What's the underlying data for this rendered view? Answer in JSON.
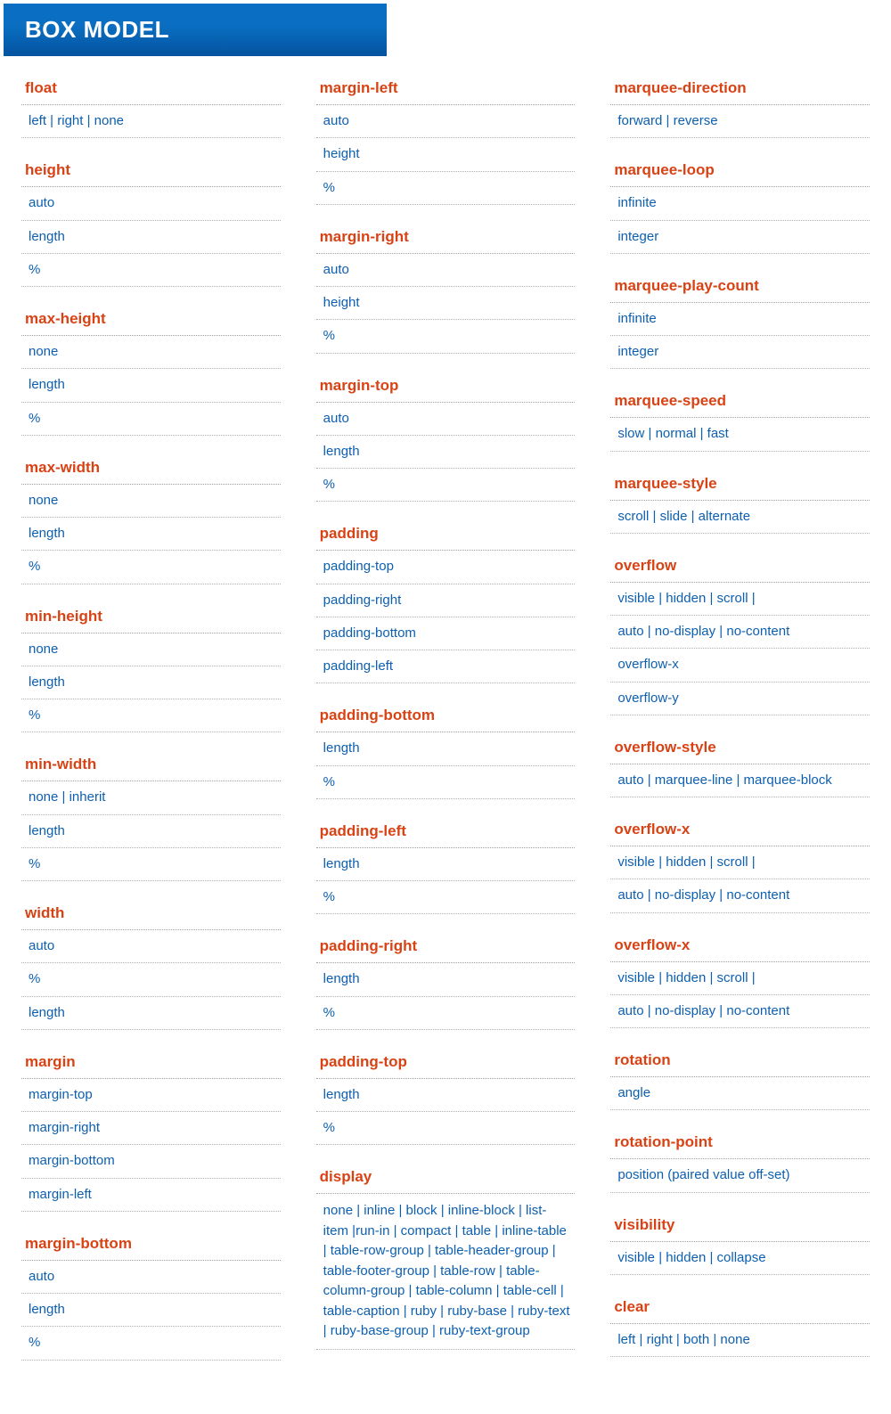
{
  "title": "BOX MODEL",
  "columns": [
    [
      {
        "name": "float",
        "values": [
          "left | right | none"
        ]
      },
      {
        "name": "height",
        "values": [
          "auto",
          "length",
          "%"
        ]
      },
      {
        "name": "max-height",
        "values": [
          "none",
          "length",
          "%"
        ]
      },
      {
        "name": "max-width",
        "values": [
          "none",
          "length",
          "%"
        ]
      },
      {
        "name": "min-height",
        "values": [
          "none",
          "length",
          "%"
        ]
      },
      {
        "name": "min-width",
        "values": [
          "none | inherit",
          "length",
          "%"
        ]
      },
      {
        "name": "width",
        "values": [
          "auto",
          "%",
          "length"
        ]
      },
      {
        "name": "margin",
        "values": [
          "margin-top",
          "margin-right",
          "margin-bottom",
          "margin-left"
        ]
      },
      {
        "name": "margin-bottom",
        "values": [
          "auto",
          "length",
          "%"
        ]
      }
    ],
    [
      {
        "name": "margin-left",
        "values": [
          "auto",
          "height",
          "%"
        ]
      },
      {
        "name": "margin-right",
        "values": [
          "auto",
          "height",
          "%"
        ]
      },
      {
        "name": "margin-top",
        "values": [
          "auto",
          "length",
          "%"
        ]
      },
      {
        "name": "padding",
        "values": [
          "padding-top",
          "padding-right",
          "padding-bottom",
          "padding-left"
        ]
      },
      {
        "name": "padding-bottom",
        "values": [
          "length",
          "%"
        ]
      },
      {
        "name": "padding-left",
        "values": [
          "length",
          "%"
        ]
      },
      {
        "name": "padding-right",
        "values": [
          "length",
          "%"
        ]
      },
      {
        "name": "padding-top",
        "values": [
          "length",
          "%"
        ]
      },
      {
        "name": "display",
        "values": [
          "none | inline | block | inline-block | list-item |run-in | compact | table | inline-table | table-row-group | table-header-group | table-footer-group | table-row | table-column-group | table-column | table-cell | table-caption | ruby | ruby-base | ruby-text | ruby-base-group | ruby-text-group"
        ],
        "multiline": true
      }
    ],
    [
      {
        "name": "marquee-direction",
        "values": [
          "forward | reverse"
        ]
      },
      {
        "name": "marquee-loop",
        "values": [
          "infinite",
          "integer"
        ]
      },
      {
        "name": "marquee-play-count",
        "values": [
          "infinite",
          "integer"
        ]
      },
      {
        "name": "marquee-speed",
        "values": [
          "slow | normal | fast"
        ]
      },
      {
        "name": "marquee-style",
        "values": [
          "scroll | slide | alternate"
        ]
      },
      {
        "name": "overflow",
        "values": [
          "visible | hidden | scroll |",
          "auto | no-display | no-content",
          "overflow-x",
          "overflow-y"
        ]
      },
      {
        "name": "overflow-style",
        "values": [
          "auto | marquee-line | marquee-block"
        ]
      },
      {
        "name": "overflow-x",
        "values": [
          "visible | hidden | scroll |",
          "auto | no-display | no-content"
        ]
      },
      {
        "name": "overflow-x",
        "values": [
          "visible | hidden | scroll |",
          "auto | no-display | no-content"
        ]
      },
      {
        "name": "rotation",
        "values": [
          "angle"
        ]
      },
      {
        "name": "rotation-point",
        "values": [
          "position (paired value off-set)"
        ]
      },
      {
        "name": "visibility",
        "values": [
          "visible | hidden | collapse"
        ]
      },
      {
        "name": "clear",
        "values": [
          "left | right | both | none"
        ]
      }
    ]
  ]
}
